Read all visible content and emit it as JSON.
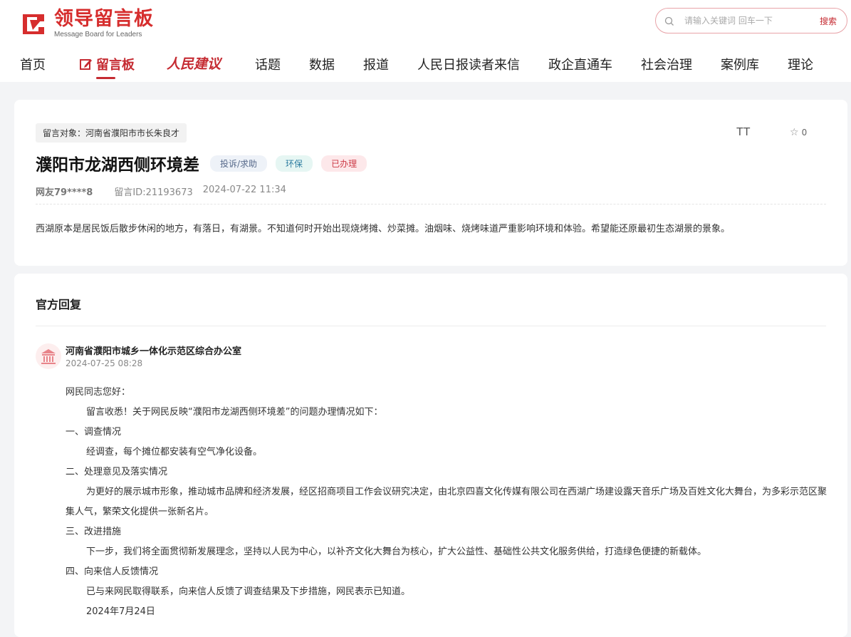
{
  "header": {
    "logo_title": "领导留言板",
    "logo_sub": "Message Board for Leaders",
    "search_placeholder": "请输入关键词 回车一下",
    "search_button": "搜索"
  },
  "nav": {
    "items": [
      "首页",
      "留言板",
      "人民建议",
      "话题",
      "数据",
      "报道",
      "人民日报读者来信",
      "政企直通车",
      "社会治理",
      "案例库",
      "理论"
    ],
    "active": "留言板"
  },
  "message": {
    "target": "留言对象：河南省濮阳市市长朱良才",
    "title": "濮阳市龙湖西侧环境差",
    "tags": [
      "投诉/求助",
      "环保",
      "已办理"
    ],
    "user": "网友79****8",
    "id_text": "留言ID:21193673",
    "time": "2024-07-22 11:34",
    "content": "西湖原本是居民饭后散步休闲的地方，有落日，有湖景。不知道何时开始出现烧烤摊、炒菜摊。油烟味、烧烤味道严重影响环境和体验。希望能还原最初生态湖景的景象。",
    "font_toggle": "TT",
    "fav_count": "0"
  },
  "reply": {
    "section_title": "官方回复",
    "org": "河南省濮阳市城乡一体化示范区综合办公室",
    "time": "2024-07-25 08:28",
    "paragraphs": [
      "网民同志您好：",
      "留言收悉！关于网民反映“濮阳市龙湖西侧环境差”的问题办理情况如下：",
      "一、调查情况",
      "经调查，每个摊位都安装有空气净化设备。",
      "二、处理意见及落实情况",
      "为更好的展示城市形象，推动城市品牌和经济发展，经区招商项目工作会议研究决定，由北京四喜文化传媒有限公司在西湖广场建设露天音乐广场及百姓文化大舞台，为多彩示范区聚集人气，繁荣文化提供一张新名片。",
      "三、改进措施",
      "下一步，我们将全面贯彻新发展理念，坚持以人民为中心，以补齐文化大舞台为核心，扩大公益性、基础性公共文化服务供给，打造绿色便捷的新载体。",
      "四、向来信人反馈情况",
      "已与来网民取得联系，向来信人反馈了调查结果及下步措施，网民表示已知道。",
      "2024年7月24日"
    ]
  },
  "colors": {
    "brand_red": "#c52b32",
    "tag_done": "#cc3a46",
    "tag_env": "#2f7ea1",
    "tag_type": "#56698a"
  }
}
